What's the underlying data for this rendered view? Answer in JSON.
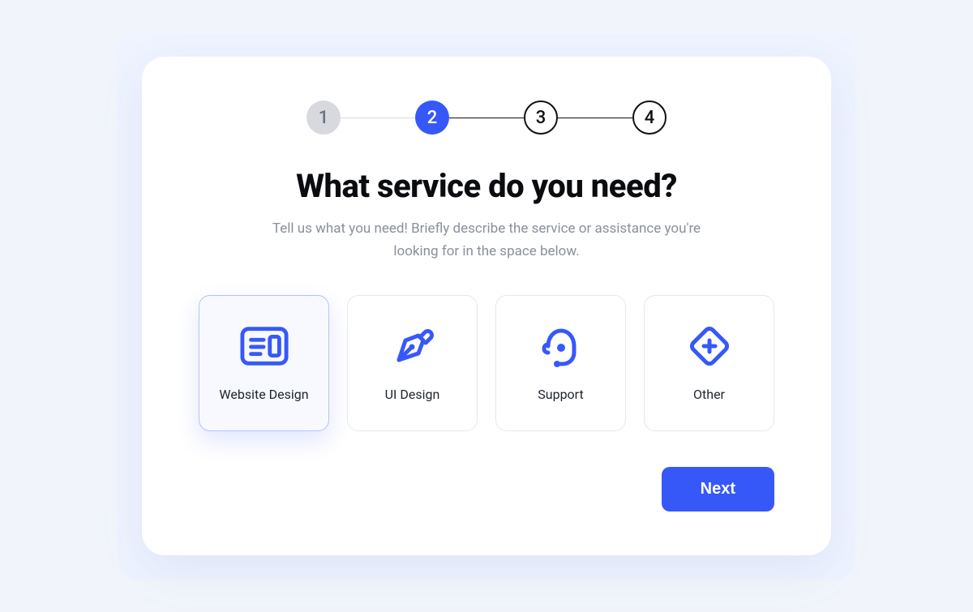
{
  "colors": {
    "primary": "#3758f9",
    "muted": "#8a8f9c",
    "step_past_bg": "#d7d9de",
    "border": "#e6e8ee"
  },
  "stepper": {
    "current": 2,
    "steps": [
      {
        "number": "1",
        "state": "past"
      },
      {
        "number": "2",
        "state": "current"
      },
      {
        "number": "3",
        "state": "future"
      },
      {
        "number": "4",
        "state": "future"
      }
    ]
  },
  "heading": "What service do you need?",
  "subheading": "Tell us what you need! Briefly describe the service or assistance you're looking for in the space below.",
  "options": [
    {
      "id": "website-design",
      "label": "Website Design",
      "icon": "layout-icon",
      "selected": true
    },
    {
      "id": "ui-design",
      "label": "UI Design",
      "icon": "pen-nib-icon",
      "selected": false
    },
    {
      "id": "support",
      "label": "Support",
      "icon": "headset-icon",
      "selected": false
    },
    {
      "id": "other",
      "label": "Other",
      "icon": "diamond-plus-icon",
      "selected": false
    }
  ],
  "actions": {
    "next_label": "Next"
  }
}
